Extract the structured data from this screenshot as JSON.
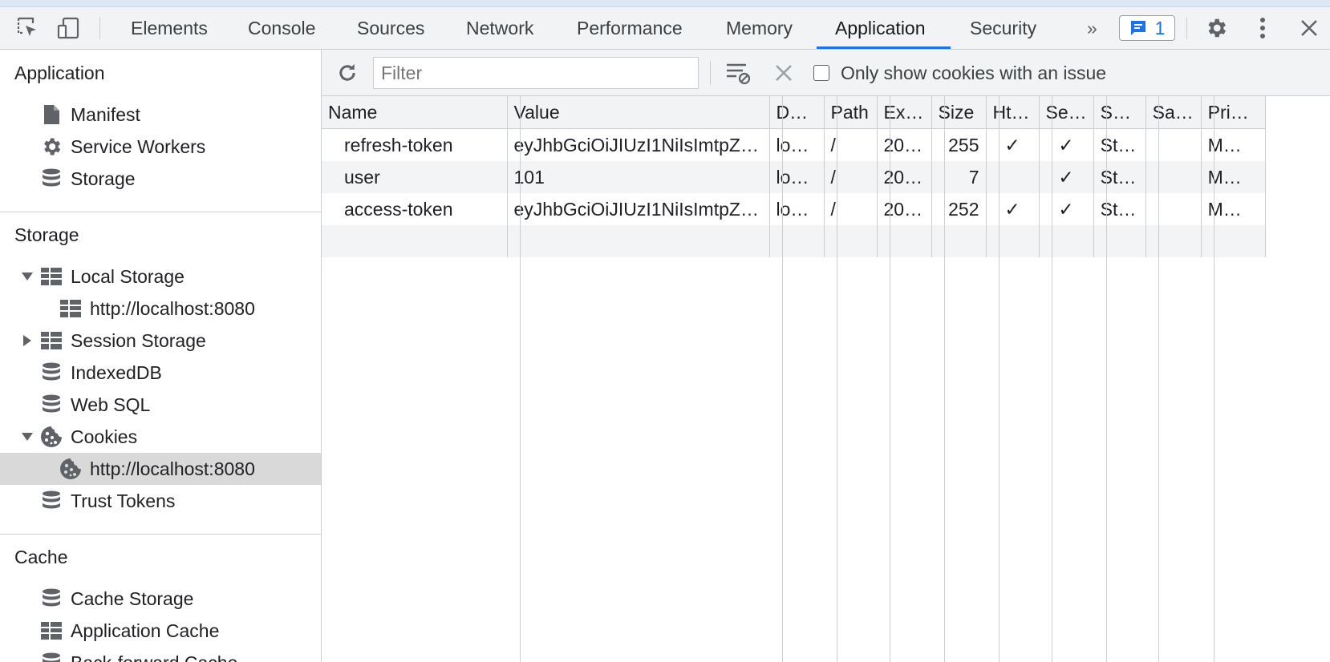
{
  "tabbar": {
    "tabs": [
      "Elements",
      "Console",
      "Sources",
      "Network",
      "Performance",
      "Memory",
      "Application",
      "Security"
    ],
    "active_tab": "Application",
    "more_label": "»",
    "issues_count": "1"
  },
  "sidebar": {
    "application": {
      "header": "Application",
      "items": [
        {
          "label": "Manifest",
          "icon": "document-icon"
        },
        {
          "label": "Service Workers",
          "icon": "gear-icon"
        },
        {
          "label": "Storage",
          "icon": "database-icon"
        }
      ]
    },
    "storage": {
      "header": "Storage",
      "local_storage": "Local Storage",
      "local_storage_origin": "http://localhost:8080",
      "session_storage": "Session Storage",
      "indexeddb": "IndexedDB",
      "websql": "Web SQL",
      "cookies": "Cookies",
      "cookies_origin": "http://localhost:8080",
      "trust_tokens": "Trust Tokens"
    },
    "cache": {
      "header": "Cache",
      "cache_storage": "Cache Storage",
      "application_cache": "Application Cache",
      "back_forward_cache": "Back-forward Cache"
    }
  },
  "toolbar": {
    "filter_placeholder": "Filter",
    "only_issues_label": "Only show cookies with an issue",
    "only_issues_checked": false
  },
  "cookies_table": {
    "columns": [
      "Name",
      "Value",
      "D…",
      "Path",
      "Ex…",
      "Size",
      "Ht…",
      "Se…",
      "S…",
      "Sa…",
      "Pri…"
    ],
    "rows": [
      [
        "refresh-token",
        "eyJhbGciOiJIUzI1NiIsImtpZ…",
        "lo…",
        "/",
        "20…",
        "255",
        "✓",
        "✓",
        "St…",
        "",
        "M…"
      ],
      [
        "user",
        "101",
        "lo…",
        "/",
        "20…",
        "7",
        "",
        "✓",
        "St…",
        "",
        "M…"
      ],
      [
        "access-token",
        "eyJhbGciOiJIUzI1NiIsImtpZ…",
        "lo…",
        "/",
        "20…",
        "252",
        "✓",
        "✓",
        "St…",
        "",
        "M…"
      ]
    ]
  },
  "colors": {
    "accent": "#1a73e8",
    "selected_row": "#d9d9d9",
    "toolbar_bg": "#f1f3f4"
  }
}
